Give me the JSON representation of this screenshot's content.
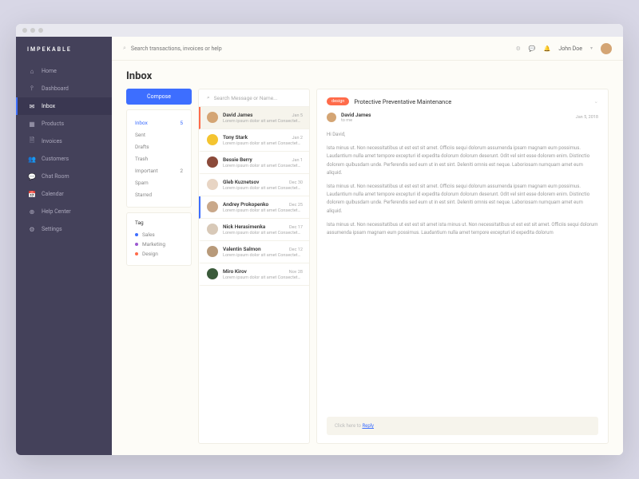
{
  "brand": "IMPEKABLE",
  "topbar": {
    "search_placeholder": "Search transactions, invoices or help",
    "user_name": "John Doe"
  },
  "nav": [
    {
      "icon": "⌂",
      "label": "Home"
    },
    {
      "icon": "⫯",
      "label": "Dashboard"
    },
    {
      "icon": "✉",
      "label": "Inbox",
      "active": true
    },
    {
      "icon": "▦",
      "label": "Products"
    },
    {
      "icon": "🗎",
      "label": "Invoices"
    },
    {
      "icon": "👥",
      "label": "Customers"
    },
    {
      "icon": "💬",
      "label": "Chat Room"
    },
    {
      "icon": "📅",
      "label": "Calendar"
    },
    {
      "icon": "⊕",
      "label": "Help Center"
    },
    {
      "icon": "⚙",
      "label": "Settings"
    }
  ],
  "page_title": "Inbox",
  "compose_label": "Compose",
  "folders": [
    {
      "name": "Inbox",
      "count": "5",
      "active": true
    },
    {
      "name": "Sent"
    },
    {
      "name": "Drafts"
    },
    {
      "name": "Trash"
    },
    {
      "name": "Important",
      "count": "2"
    },
    {
      "name": "Spam"
    },
    {
      "name": "Starred"
    }
  ],
  "tags_title": "Tag",
  "tags": [
    {
      "color": "#3d6eff",
      "label": "Sales"
    },
    {
      "color": "#9b59d0",
      "label": "Marketing"
    },
    {
      "color": "#ff6b4a",
      "label": "Design"
    }
  ],
  "msg_search_placeholder": "Search Message or Name...",
  "messages": [
    {
      "name": "David James",
      "preview": "Lorem ipsum dolor sit amet Consectetur...",
      "date": "Jan 5",
      "color": "#d4a574",
      "selected": true
    },
    {
      "name": "Tony Stark",
      "preview": "Lorem ipsum dolor sit amet Consectetur...",
      "date": "Jan 2",
      "color": "#f4c430"
    },
    {
      "name": "Bessie Berry",
      "preview": "Lorem ipsum dolor sit amet Consectetur...",
      "date": "Jan 1",
      "color": "#8b4a3a"
    },
    {
      "name": "Gleb Kuznetsov",
      "preview": "Lorem ipsum dolor sit amet Consectetur...",
      "date": "Dec 30",
      "color": "#e8d5c4"
    },
    {
      "name": "Andrey Prokopenko",
      "preview": "Lorem ipsum dolor sit amet Consectetur...",
      "date": "Dec 25",
      "color": "#c9a88a",
      "unread": true
    },
    {
      "name": "Nick Herasimenka",
      "preview": "Lorem ipsum dolor sit amet Consectetur...",
      "date": "Dec 17",
      "color": "#d8c9b8"
    },
    {
      "name": "Valentin Salmon",
      "preview": "Lorem ipsum dolor sit amet Consectetur...",
      "date": "Dec 12",
      "color": "#b89a7a"
    },
    {
      "name": "Miro Kirov",
      "preview": "Lorem ipsum dolor sit amet Consectetur...",
      "date": "Nov 28",
      "color": "#3a5a3a"
    }
  ],
  "email": {
    "badge": "design",
    "subject": "Protective Preventative Maintenance",
    "from_name": "David James",
    "to": "to me",
    "date": "Jan 5, 2018",
    "greeting": "Hi David,",
    "p1": "Ista minus ut. Non necessitatibus ut est est sit amet. Officiis sequi dolorum assumenda ipsam magnam eum possimus. Laudantium nulla amet tempore excepturi id expedita dolorum dolorum deserunt. Odit vel sint esse dolorem enim. Distinctio dolorem quibusdam unde. Perferendis sed eum ut in est sint. Deleniti omnis est neque. Laboriosam numquam amet eum aliquid.",
    "p2": "Ista minus ut. Non necessitatibus ut est est sit amet. Officiis sequi dolorum assumenda ipsam magnam eum possimus. Laudantium nulla amet tempore excepturi id expedita dolorum dolorum deserunt. Odit vel sint esse dolorem enim. Distinctio dolorem quibusdam unde. Perferendis sed eum ut in est sint. Deleniti omnis est neque. Laboriosam numquam amet eum aliquid.",
    "p3": "Ista minus ut. Non necessitatibus ut est est sit amet ista minus ut. Non necessitatibus ut est est sit amet. Officiis sequi dolorum assumenda ipsam magnam eum possimus. Laudantium nulla amet tempore excepturi id expedita dolorum",
    "reply_prefix": "Click here to ",
    "reply_link": "Reply"
  }
}
